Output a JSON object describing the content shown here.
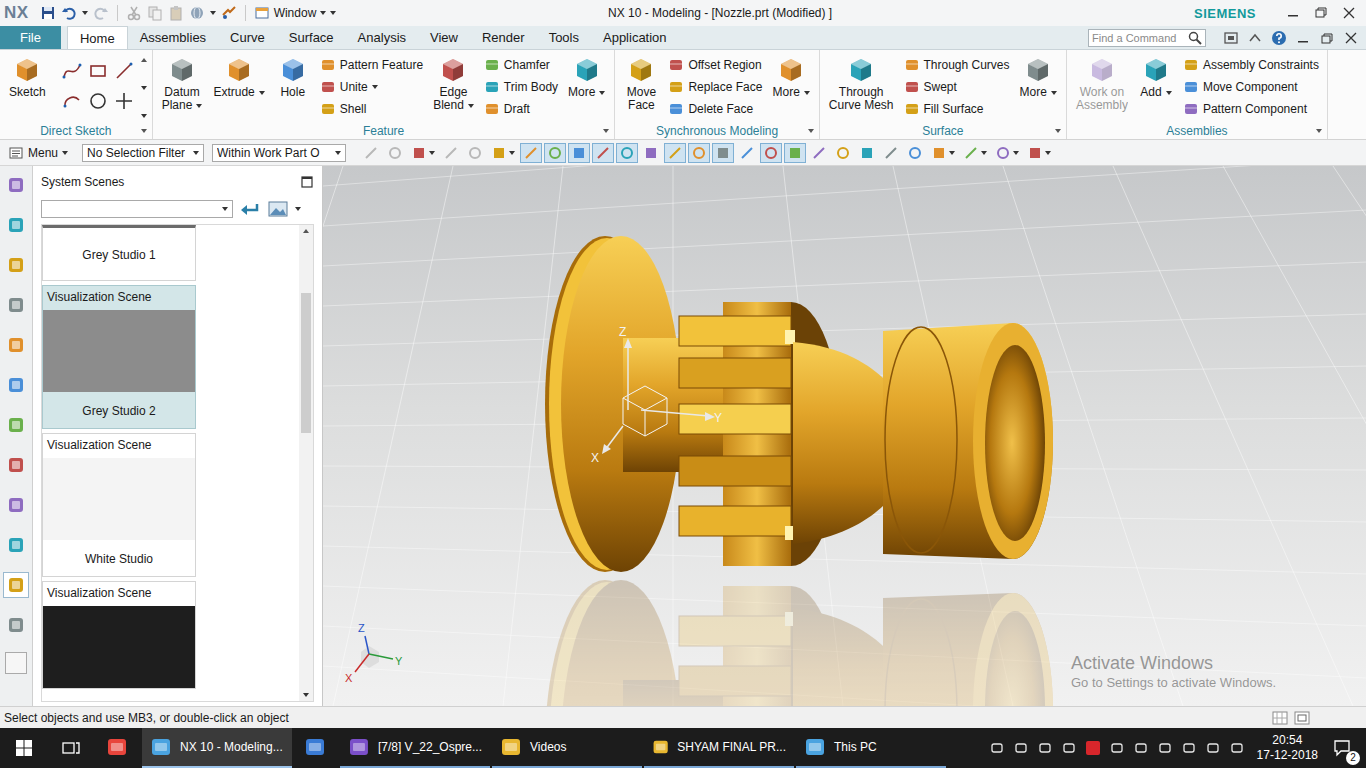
{
  "title_bar": {
    "logo": "NX",
    "window_menu": "Window",
    "title": "NX 10 - Modeling - [Nozzle.prt (Modified) ]",
    "brand": "SIEMENS"
  },
  "tabs": [
    {
      "label": "File",
      "kind": "file",
      "selected": false
    },
    {
      "label": "Home",
      "kind": "tab",
      "selected": true
    },
    {
      "label": "Assemblies",
      "kind": "tab",
      "selected": false
    },
    {
      "label": "Curve",
      "kind": "tab",
      "selected": false
    },
    {
      "label": "Surface",
      "kind": "tab",
      "selected": false
    },
    {
      "label": "Analysis",
      "kind": "tab",
      "selected": false
    },
    {
      "label": "View",
      "kind": "tab",
      "selected": false
    },
    {
      "label": "Render",
      "kind": "tab",
      "selected": false
    },
    {
      "label": "Tools",
      "kind": "tab",
      "selected": false
    },
    {
      "label": "Application",
      "kind": "tab",
      "selected": false
    }
  ],
  "search": {
    "placeholder": "Find a Command"
  },
  "ribbon": [
    {
      "label": "Direct Sketch",
      "items": [
        {
          "kind": "large",
          "lines": [
            "Sketch"
          ],
          "menu": false,
          "disabled": false
        },
        {
          "kind": "grid"
        }
      ]
    },
    {
      "label": "Feature",
      "items": [
        {
          "kind": "large",
          "lines": [
            "Datum",
            "Plane"
          ],
          "menu": true,
          "disabled": false
        },
        {
          "kind": "large",
          "lines": [
            "Extrude"
          ],
          "menu": true,
          "disabled": false
        },
        {
          "kind": "large",
          "lines": [
            "Hole"
          ],
          "menu": false,
          "disabled": false
        },
        {
          "kind": "column",
          "entries": [
            {
              "label": "Pattern Feature",
              "menu": false
            },
            {
              "label": "Unite",
              "menu": true
            },
            {
              "label": "Shell",
              "menu": false
            }
          ]
        },
        {
          "kind": "large",
          "lines": [
            "Edge",
            "Blend"
          ],
          "menu": true,
          "disabled": false
        },
        {
          "kind": "column",
          "entries": [
            {
              "label": "Chamfer",
              "menu": false
            },
            {
              "label": "Trim Body",
              "menu": false
            },
            {
              "label": "Draft",
              "menu": false
            }
          ]
        },
        {
          "kind": "large",
          "lines": [
            "More"
          ],
          "menu": true,
          "disabled": false
        }
      ]
    },
    {
      "label": "Synchronous Modeling",
      "items": [
        {
          "kind": "large",
          "lines": [
            "Move",
            "Face"
          ],
          "menu": false,
          "disabled": false
        },
        {
          "kind": "column",
          "entries": [
            {
              "label": "Offset Region",
              "menu": false
            },
            {
              "label": "Replace Face",
              "menu": false
            },
            {
              "label": "Delete Face",
              "menu": false
            }
          ]
        },
        {
          "kind": "large",
          "lines": [
            "More"
          ],
          "menu": true,
          "disabled": false
        }
      ]
    },
    {
      "label": "Surface",
      "items": [
        {
          "kind": "large",
          "lines": [
            "Through",
            "Curve Mesh"
          ],
          "menu": false,
          "disabled": false
        },
        {
          "kind": "column",
          "entries": [
            {
              "label": "Through Curves",
              "menu": false
            },
            {
              "label": "Swept",
              "menu": false
            },
            {
              "label": "Fill Surface",
              "menu": false
            }
          ]
        },
        {
          "kind": "large",
          "lines": [
            "More"
          ],
          "menu": true,
          "disabled": false
        }
      ]
    },
    {
      "label": "Assemblies",
      "items": [
        {
          "kind": "large",
          "lines": [
            "Work on",
            "Assembly"
          ],
          "menu": false,
          "disabled": true
        },
        {
          "kind": "large",
          "lines": [
            "Add"
          ],
          "menu": true,
          "disabled": false
        },
        {
          "kind": "column",
          "entries": [
            {
              "label": "Assembly Constraints",
              "menu": false
            },
            {
              "label": "Move Component",
              "menu": false
            },
            {
              "label": "Pattern Component",
              "menu": false
            }
          ]
        }
      ]
    }
  ],
  "toolbar": {
    "menu": "Menu",
    "filters": [
      {
        "value": "No Selection Filter"
      },
      {
        "value": "Within Work Part O"
      }
    ],
    "icons": [
      {
        "pressed": false,
        "menu": false,
        "disabled": true
      },
      {
        "pressed": false,
        "menu": false,
        "disabled": true
      },
      {
        "pressed": false,
        "menu": true,
        "disabled": false
      },
      {
        "pressed": false,
        "menu": false,
        "disabled": true
      },
      {
        "pressed": false,
        "menu": false,
        "disabled": true
      },
      {
        "pressed": false,
        "menu": true,
        "disabled": false
      },
      {
        "pressed": true,
        "menu": false,
        "disabled": false
      },
      {
        "pressed": true,
        "menu": false,
        "disabled": false
      },
      {
        "pressed": true,
        "menu": false,
        "disabled": false
      },
      {
        "pressed": true,
        "menu": false,
        "disabled": false
      },
      {
        "pressed": true,
        "menu": false,
        "disabled": false
      },
      {
        "pressed": false,
        "menu": false,
        "disabled": false
      },
      {
        "pressed": true,
        "menu": false,
        "disabled": false
      },
      {
        "pressed": true,
        "menu": false,
        "disabled": false
      },
      {
        "pressed": true,
        "menu": false,
        "disabled": false
      },
      {
        "pressed": false,
        "menu": false,
        "disabled": false
      },
      {
        "pressed": true,
        "menu": false,
        "disabled": false
      },
      {
        "pressed": true,
        "menu": false,
        "disabled": false
      },
      {
        "pressed": false,
        "menu": false,
        "disabled": false
      },
      {
        "pressed": false,
        "menu": false,
        "disabled": false
      },
      {
        "pressed": false,
        "menu": false,
        "disabled": false
      },
      {
        "pressed": false,
        "menu": false,
        "disabled": false
      },
      {
        "pressed": false,
        "menu": false,
        "disabled": false
      },
      {
        "pressed": false,
        "menu": true,
        "disabled": false
      },
      {
        "pressed": false,
        "menu": true,
        "disabled": false
      },
      {
        "pressed": false,
        "menu": true,
        "disabled": false
      },
      {
        "pressed": false,
        "menu": true,
        "disabled": false
      }
    ]
  },
  "resource_bar": {
    "icons": [
      {
        "selected": false
      },
      {
        "selected": false
      },
      {
        "selected": false
      },
      {
        "selected": false
      },
      {
        "selected": false
      },
      {
        "selected": false
      },
      {
        "selected": false
      },
      {
        "selected": false
      },
      {
        "selected": false
      },
      {
        "selected": false
      },
      {
        "selected": true
      },
      {
        "selected": false
      }
    ]
  },
  "scenes_panel": {
    "title": "System Scenes",
    "dropdown": "",
    "scenes": [
      {
        "kind": "name-only",
        "type": "",
        "name": "Grey Studio 1",
        "selected": false,
        "color": "#9a9a9a"
      },
      {
        "kind": "full",
        "type": "Visualization Scene",
        "name": "Grey Studio 2",
        "selected": true,
        "color": "#8c8c8c"
      },
      {
        "kind": "full",
        "type": "Visualization Scene",
        "name": "White Studio",
        "selected": false,
        "color": "#f4f4f4"
      },
      {
        "kind": "header-only",
        "type": "Visualization Scene",
        "name": "",
        "selected": false,
        "color": "#1e1e1e"
      }
    ]
  },
  "viewport": {
    "wcs_axes": [
      "Z",
      "Y",
      "X"
    ],
    "view_triad_axes": [
      "Z",
      "Y",
      "X"
    ],
    "watermark": [
      "Activate Windows",
      "Go to Settings to activate Windows."
    ]
  },
  "status_bar": {
    "prompt": "Select objects and use MB3, or double-click an object"
  },
  "taskbar": {
    "items": [
      {
        "kind": "icon",
        "label": "",
        "selected": false,
        "open": false
      },
      {
        "kind": "app",
        "label": "NX 10 - Modeling...",
        "selected": true,
        "open": true
      },
      {
        "kind": "icon",
        "label": "",
        "selected": false,
        "open": false
      },
      {
        "kind": "app",
        "label": "[7/8] V_22_Ospre...",
        "selected": false,
        "open": true
      },
      {
        "kind": "app",
        "label": "Videos",
        "selected": false,
        "open": true
      },
      {
        "kind": "app",
        "label": "SHYAM FINAL PR...",
        "selected": false,
        "open": true
      },
      {
        "kind": "app",
        "label": "This PC",
        "selected": false,
        "open": true
      }
    ],
    "clock": {
      "time": "20:54",
      "date": "17-12-2018"
    },
    "notifications": "2"
  }
}
